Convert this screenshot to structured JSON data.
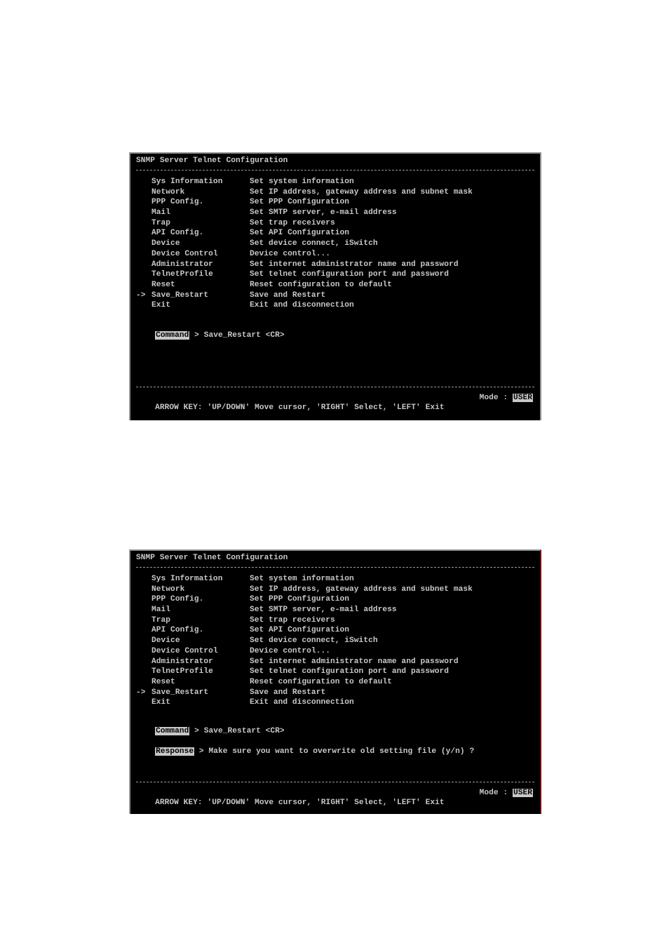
{
  "screens": [
    {
      "title": "SNMP Server Telnet Configuration",
      "menu": [
        {
          "name": "Sys Information",
          "desc": "Set system information",
          "selected": false
        },
        {
          "name": "Network",
          "desc": "Set IP address, gateway address and subnet mask",
          "selected": false
        },
        {
          "name": "PPP Config.",
          "desc": "Set PPP Configuration",
          "selected": false
        },
        {
          "name": "Mail",
          "desc": "Set SMTP server, e-mail address",
          "selected": false
        },
        {
          "name": "Trap",
          "desc": "Set trap receivers",
          "selected": false
        },
        {
          "name": "API Config.",
          "desc": "Set API Configuration",
          "selected": false
        },
        {
          "name": "Device",
          "desc": "Set device connect, iSwitch",
          "selected": false
        },
        {
          "name": "Device Control",
          "desc": "Device control...",
          "selected": false
        },
        {
          "name": "Administrator",
          "desc": "Set internet administrator name and password",
          "selected": false
        },
        {
          "name": "TelnetProfile",
          "desc": "Set telnet configuration port and password",
          "selected": false
        },
        {
          "name": "Reset",
          "desc": "Reset configuration to default",
          "selected": false
        },
        {
          "name": "Save_Restart",
          "desc": "Save and Restart",
          "selected": true
        },
        {
          "name": "Exit",
          "desc": "Exit and disconnection",
          "selected": false
        }
      ],
      "cursor_marker": "->",
      "command_label": "Command",
      "command_text": " > Save_Restart <CR>",
      "status_text": "ARROW KEY: 'UP/DOWN' Move cursor, 'RIGHT' Select, 'LEFT' Exit",
      "mode_label": "Mode : ",
      "mode_value": "USER"
    },
    {
      "title": "SNMP Server Telnet Configuration",
      "menu": [
        {
          "name": "Sys Information",
          "desc": "Set system information",
          "selected": false
        },
        {
          "name": "Network",
          "desc": "Set IP address, gateway address and subnet mask",
          "selected": false
        },
        {
          "name": "PPP Config.",
          "desc": "Set PPP Configuration",
          "selected": false
        },
        {
          "name": "Mail",
          "desc": "Set SMTP server, e-mail address",
          "selected": false
        },
        {
          "name": "Trap",
          "desc": "Set trap receivers",
          "selected": false
        },
        {
          "name": "API Config.",
          "desc": "Set API Configuration",
          "selected": false
        },
        {
          "name": "Device",
          "desc": "Set device connect, iSwitch",
          "selected": false
        },
        {
          "name": "Device Control",
          "desc": "Device control...",
          "selected": false
        },
        {
          "name": "Administrator",
          "desc": "Set internet administrator name and password",
          "selected": false
        },
        {
          "name": "TelnetProfile",
          "desc": "Set telnet configuration port and password",
          "selected": false
        },
        {
          "name": "Reset",
          "desc": "Reset configuration to default",
          "selected": false
        },
        {
          "name": "Save_Restart",
          "desc": "Save and Restart",
          "selected": true
        },
        {
          "name": "Exit",
          "desc": "Exit and disconnection",
          "selected": false
        }
      ],
      "cursor_marker": "->",
      "command_label": "Command",
      "command_text": " > Save_Restart <CR>",
      "response_label": "Response",
      "response_text": " > Make sure you want to overwrite old setting file (y/n) ?",
      "status_text": "ARROW KEY: 'UP/DOWN' Move cursor, 'RIGHT' Select, 'LEFT' Exit",
      "mode_label": "Mode : ",
      "mode_value": "USER"
    }
  ]
}
